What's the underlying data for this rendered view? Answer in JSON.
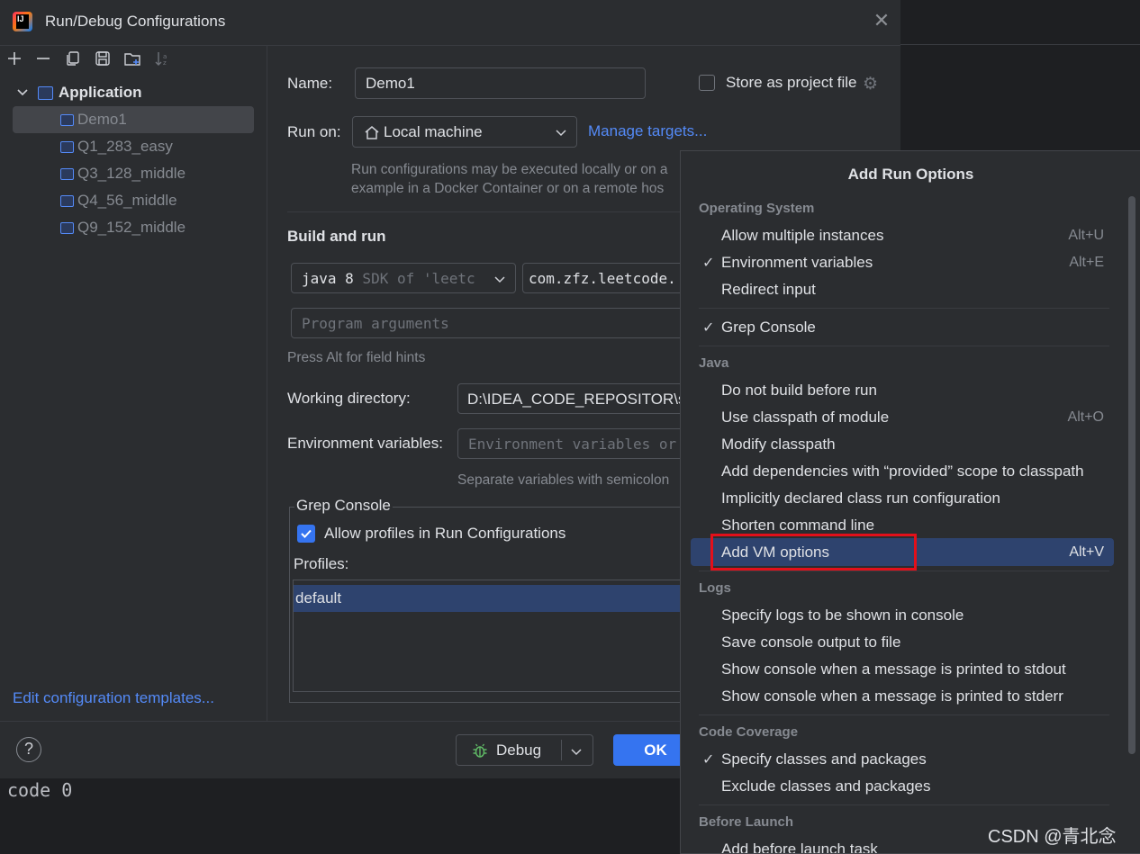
{
  "window": {
    "title": "Run/Debug Configurations"
  },
  "toolbar": {
    "icons": [
      "add-icon",
      "remove-icon",
      "copy-icon",
      "save-icon",
      "new-folder-icon",
      "sort-icon"
    ]
  },
  "tree": {
    "root": "Application",
    "items": [
      "Demo1",
      "Q1_283_easy",
      "Q3_128_middle",
      "Q4_56_middle",
      "Q9_152_middle"
    ],
    "selected": "Demo1"
  },
  "left_footer": {
    "edit_templates": "Edit configuration templates..."
  },
  "form": {
    "name_label": "Name:",
    "name_value": "Demo1",
    "store_label": "Store as project file",
    "run_on_label": "Run on:",
    "run_on_value": "Local machine",
    "manage_targets": "Manage targets...",
    "run_hint_line1": "Run configurations may be executed locally or on a",
    "run_hint_line2": "example in a Docker Container or on a remote hos",
    "build_run_title": "Build and run",
    "sdk_java": "java 8",
    "sdk_rest": " SDK of 'leetc",
    "main_class": "com.zfz.leetcode.",
    "program_args_placeholder": "Program arguments",
    "alt_hint": "Press Alt for field hints",
    "working_dir_label": "Working directory:",
    "working_dir_value": "D:\\IDEA_CODE_REPOSITOR\\spr",
    "env_label": "Environment variables:",
    "env_placeholder": "Environment variables or",
    "env_hint": "Separate variables with semicolon",
    "grep_title": "Grep Console",
    "allow_profiles": "Allow profiles in Run Configurations",
    "profiles_label": "Profiles:",
    "profile_default": "default"
  },
  "buttons": {
    "help": "?",
    "debug": "Debug",
    "ok": "OK"
  },
  "console": {
    "text": "code 0"
  },
  "popup": {
    "title": "Add Run Options",
    "groups": {
      "os": "Operating System",
      "java": "Java",
      "logs": "Logs",
      "coverage": "Code Coverage",
      "before_launch": "Before Launch"
    },
    "os_items": [
      {
        "label": "Allow multiple instances",
        "shortcut": "Alt+U"
      },
      {
        "label": "Environment variables",
        "shortcut": "Alt+E"
      },
      {
        "label": "Redirect input",
        "shortcut": ""
      }
    ],
    "grep_console": "Grep Console",
    "java_items": [
      {
        "label": "Do not build before run",
        "shortcut": ""
      },
      {
        "label": "Use classpath of module",
        "shortcut": "Alt+O"
      },
      {
        "label": "Modify classpath",
        "shortcut": ""
      },
      {
        "label": "Add dependencies with “provided” scope to classpath",
        "shortcut": ""
      },
      {
        "label": "Implicitly declared class run configuration",
        "shortcut": ""
      },
      {
        "label": "Shorten command line",
        "shortcut": ""
      },
      {
        "label": "Add VM options",
        "shortcut": "Alt+V"
      }
    ],
    "logs_items": [
      "Specify logs to be shown in console",
      "Save console output to file",
      "Show console when a message is printed to stdout",
      "Show console when a message is printed to stderr"
    ],
    "coverage_items": [
      "Specify classes and packages",
      "Exclude classes and packages"
    ],
    "before_launch_partial": "Add before launch task"
  },
  "watermark": "CSDN @青北念",
  "colors": {
    "accent": "#3574f0",
    "link": "#548af7",
    "highlight": "#2e436e",
    "annotation_red": "#e3101a"
  }
}
